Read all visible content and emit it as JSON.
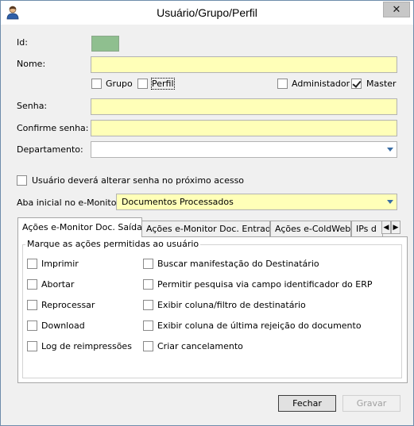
{
  "window": {
    "title": "Usuário/Grupo/Perfil",
    "close_glyph": "✕"
  },
  "form": {
    "id_label": "Id:",
    "nome_label": "Nome:",
    "nome_value": "",
    "grupo_label": "Grupo",
    "grupo_checked": false,
    "perfil_label": "Perfil",
    "perfil_checked": false,
    "administrador_label": "Administador",
    "administrador_checked": false,
    "master_label": "Master",
    "master_checked": true,
    "senha_label": "Senha:",
    "senha_value": "",
    "confirme_label": "Confirme senha:",
    "confirme_value": "",
    "departamento_label": "Departamento:",
    "departamento_value": "",
    "alterar_senha_label": "Usuário deverá alterar senha no próximo acesso",
    "alterar_senha_checked": false,
    "aba_inicial_label": "Aba inicial no e-Monitor:",
    "aba_inicial_value": "Documentos Processados"
  },
  "tabs": [
    {
      "label": "Ações e-Monitor Doc. Saída",
      "active": true
    },
    {
      "label": "Ações e-Monitor Doc. Entrada",
      "active": false
    },
    {
      "label": "Ações e-ColdWeb",
      "active": false
    },
    {
      "label": "IPs d",
      "active": false
    }
  ],
  "tab_scroll": {
    "left": "◀",
    "right": "▶"
  },
  "permissions": {
    "group_title": "Marque as ações permitidas ao usuário",
    "left": [
      "Imprimir",
      "Abortar",
      "Reprocessar",
      "Download",
      "Log de reimpressões"
    ],
    "right": [
      "Buscar manifestação do Destinatário",
      "Permitir pesquisa via campo identificador do ERP",
      "Exibir coluna/filtro de destinatário",
      "Exibir coluna de última rejeição do documento",
      "Criar cancelamento"
    ]
  },
  "buttons": {
    "fechar": "Fechar",
    "gravar": "Gravar"
  },
  "colors": {
    "required_field": "#ffffb8",
    "id_box": "#8fbf8f",
    "combo_arrow": "#3a6ea5"
  }
}
